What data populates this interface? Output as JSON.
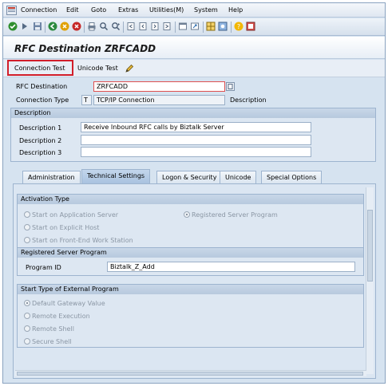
{
  "menu": {
    "items": [
      "Connection",
      "Edit",
      "Goto",
      "Extras",
      "Utilities(M)",
      "System",
      "Help"
    ]
  },
  "toolbar": {
    "icons": [
      "check-icon",
      "back-icon",
      "save-icon",
      "back-nav-icon",
      "exit-icon",
      "cancel-icon",
      "print-icon",
      "find-icon",
      "find-next-icon",
      "first-page-icon",
      "prev-page-icon",
      "next-page-icon",
      "last-page-icon",
      "new-session-icon",
      "shortcut-icon",
      "help-icon",
      "layout-icon"
    ]
  },
  "title": "RFC Destination ZRFCADD",
  "app_toolbar": {
    "connection_test": "Connection Test",
    "unicode_test": "Unicode Test"
  },
  "header": {
    "rfc_destination_label": "RFC Destination",
    "rfc_destination_value": "ZRFCADD",
    "connection_type_label": "Connection Type",
    "connection_type_code": "T",
    "connection_type_value": "TCP/IP Connection",
    "description_label": "Description"
  },
  "description": {
    "title": "Description",
    "d1_label": "Description 1",
    "d1_value": "Receive Inbound RFC calls by Biztalk Server",
    "d2_label": "Description 2",
    "d2_value": "",
    "d3_label": "Description 3",
    "d3_value": ""
  },
  "tabs": [
    "Administration",
    "Technical Settings",
    "Logon & Security",
    "Unicode",
    "Special Options"
  ],
  "active_tab": "Technical Settings",
  "activation": {
    "title": "Activation Type",
    "options": [
      "Start on Application Server",
      "Registered Server Program",
      "Start on Explicit Host",
      "Start on Front-End Work Station"
    ],
    "selected": "Registered Server Program"
  },
  "registered": {
    "title": "Registered Server Program",
    "program_id_label": "Program ID",
    "program_id_value": "Biztalk_Z_Add"
  },
  "start_type": {
    "title": "Start Type of External Program",
    "options": [
      "Default Gateway Value",
      "Remote Execution",
      "Remote Shell",
      "Secure Shell"
    ],
    "selected": "Default Gateway Value"
  },
  "colors": {
    "highlight": "#d21e2a",
    "panel": "#d6e3f0"
  }
}
